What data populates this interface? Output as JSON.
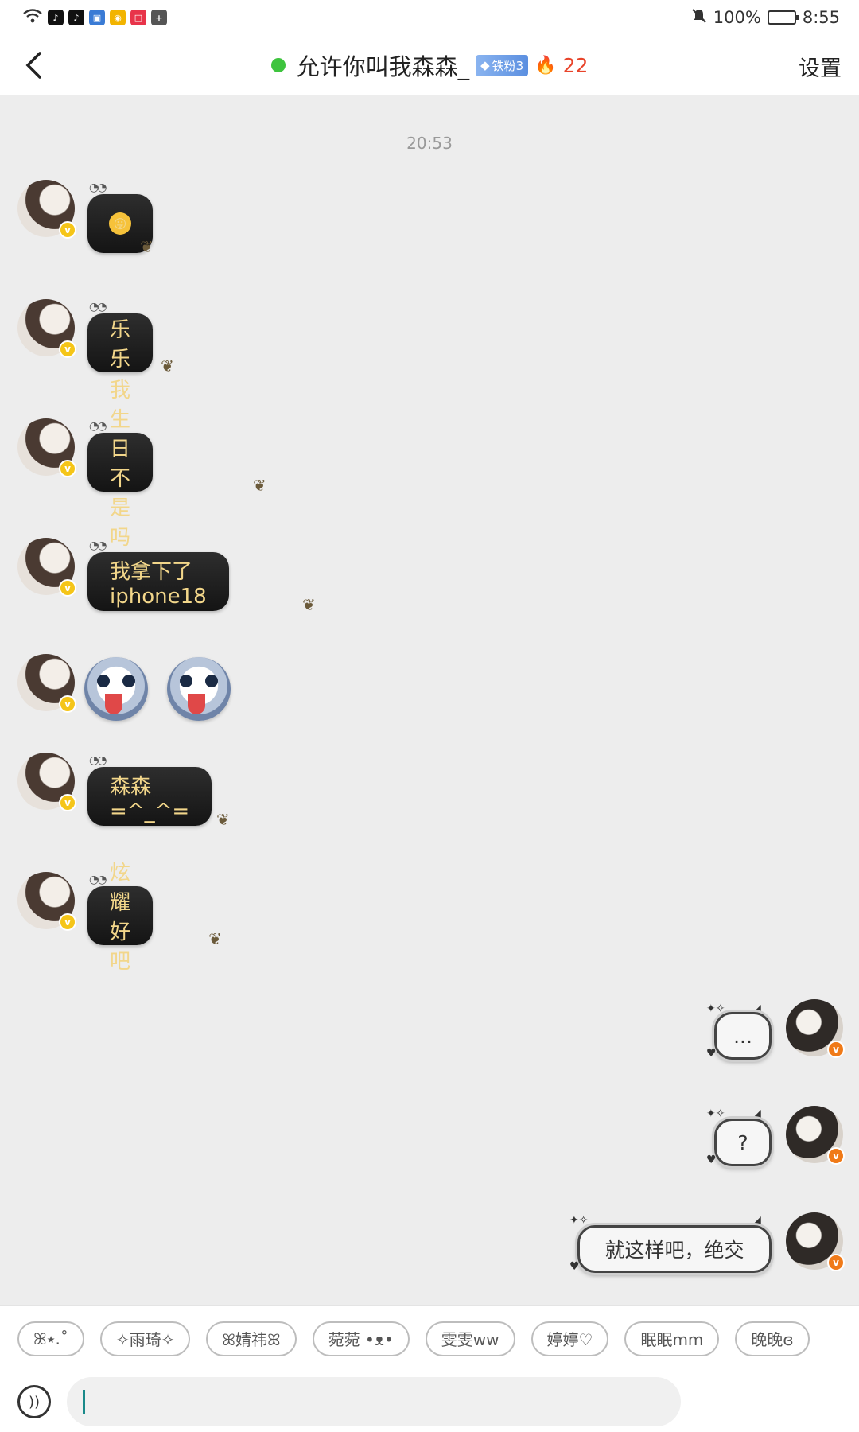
{
  "status_bar": {
    "battery_text": "100%",
    "time": "8:55",
    "icons": [
      "wifi-icon",
      "tiktok-icon",
      "tiktok-icon",
      "notes-icon",
      "weibo-icon",
      "red-app-icon",
      "plus-box-icon",
      "mute-bell-icon",
      "battery-icon"
    ]
  },
  "header": {
    "title": "允许你叫我森森_",
    "fan_badge": "铁粉3",
    "streak_count": "22",
    "settings_label": "设置",
    "online_color": "#3ec43e"
  },
  "chat": {
    "timestamp": "20:53",
    "received": [
      {
        "type": "emoji",
        "emoji": "😛"
      },
      {
        "type": "text",
        "text": "乐乐"
      },
      {
        "type": "text",
        "text": "我生日不是吗"
      },
      {
        "type": "text",
        "text": "我拿下了iphone18"
      },
      {
        "type": "stickers",
        "sticker": "husky-tongue"
      },
      {
        "type": "text",
        "text": "森森=^_^="
      },
      {
        "type": "text",
        "text": "炫耀好吧"
      }
    ],
    "sent": [
      {
        "text": "..."
      },
      {
        "text": "?"
      },
      {
        "text": "就这样吧，绝交"
      }
    ]
  },
  "quick_replies": [
    "ꕤ٭.˚",
    "✧雨琦✧",
    "ꕤ婧祎ꕤ",
    "菀菀 •ᴥ•",
    "雯雯ww",
    "婷婷♡",
    "眠眠mm",
    "晚晚ɞ"
  ],
  "input": {
    "value": ""
  },
  "colors": {
    "bubble_text": "#f2d68a",
    "accent_badge": "#f5c518",
    "me_badge": "#f07a18"
  }
}
